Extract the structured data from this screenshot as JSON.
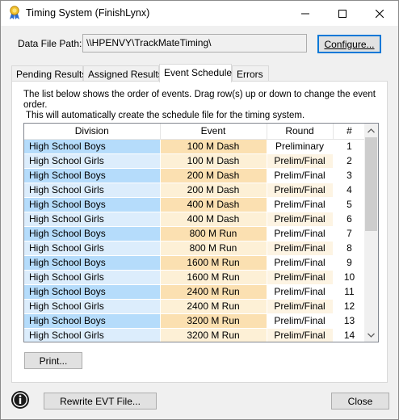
{
  "window": {
    "title": "Timing System (FinishLynx)"
  },
  "path": {
    "label": "Data File Path:",
    "value": "\\\\HPENVY\\TrackMateTiming\\",
    "configure_label": "Configure..."
  },
  "tabs": [
    {
      "label": "Pending Results",
      "active": false
    },
    {
      "label": "Assigned Results",
      "active": false
    },
    {
      "label": "Event Schedule",
      "active": true
    },
    {
      "label": "Errors",
      "active": false
    }
  ],
  "description": {
    "line1": "The list below shows the order of events.  Drag row(s) up or down to change the event order.",
    "line2": "This will automatically create the schedule file for the timing system."
  },
  "grid": {
    "columns": [
      "Division",
      "Event",
      "Round",
      "#"
    ],
    "rows": [
      {
        "division": "High School Boys",
        "event": "100 M Dash",
        "round": "Preliminary",
        "num": "1"
      },
      {
        "division": "High School Girls",
        "event": "100 M Dash",
        "round": "Prelim/Final",
        "num": "2"
      },
      {
        "division": "High School Boys",
        "event": "200 M Dash",
        "round": "Prelim/Final",
        "num": "3"
      },
      {
        "division": "High School Girls",
        "event": "200 M Dash",
        "round": "Prelim/Final",
        "num": "4"
      },
      {
        "division": "High School Boys",
        "event": "400 M Dash",
        "round": "Prelim/Final",
        "num": "5"
      },
      {
        "division": "High School Girls",
        "event": "400 M Dash",
        "round": "Prelim/Final",
        "num": "6"
      },
      {
        "division": "High School Boys",
        "event": "800 M Run",
        "round": "Prelim/Final",
        "num": "7"
      },
      {
        "division": "High School Girls",
        "event": "800 M Run",
        "round": "Prelim/Final",
        "num": "8"
      },
      {
        "division": "High School Boys",
        "event": "1600 M Run",
        "round": "Prelim/Final",
        "num": "9"
      },
      {
        "division": "High School Girls",
        "event": "1600 M Run",
        "round": "Prelim/Final",
        "num": "10"
      },
      {
        "division": "High School Boys",
        "event": "2400 M Run",
        "round": "Prelim/Final",
        "num": "11"
      },
      {
        "division": "High School Girls",
        "event": "2400 M Run",
        "round": "Prelim/Final",
        "num": "12"
      },
      {
        "division": "High School Boys",
        "event": "3200 M Run",
        "round": "Prelim/Final",
        "num": "13"
      },
      {
        "division": "High School Girls",
        "event": "3200 M Run",
        "round": "Prelim/Final",
        "num": "14"
      }
    ]
  },
  "colors": {
    "boys_division_bg": "#b5dcfb",
    "girls_division_bg": "#dcedfc",
    "boys_event_bg": "#fbe0b1",
    "girls_event_bg": "#fdf0d6",
    "boys_round_bg": "#ffffff",
    "girls_round_bg": "#fdf4e3",
    "accent": "#0078d7"
  },
  "buttons": {
    "print_label": "Print...",
    "rewrite_label": "Rewrite EVT File...",
    "close_label": "Close"
  },
  "icons": {
    "app": "award-ribbon-icon",
    "info": "info-icon",
    "minimize": "minimize-icon",
    "maximize": "maximize-icon",
    "close": "close-icon",
    "scroll_up": "chevron-up-icon",
    "scroll_down": "chevron-down-icon"
  }
}
